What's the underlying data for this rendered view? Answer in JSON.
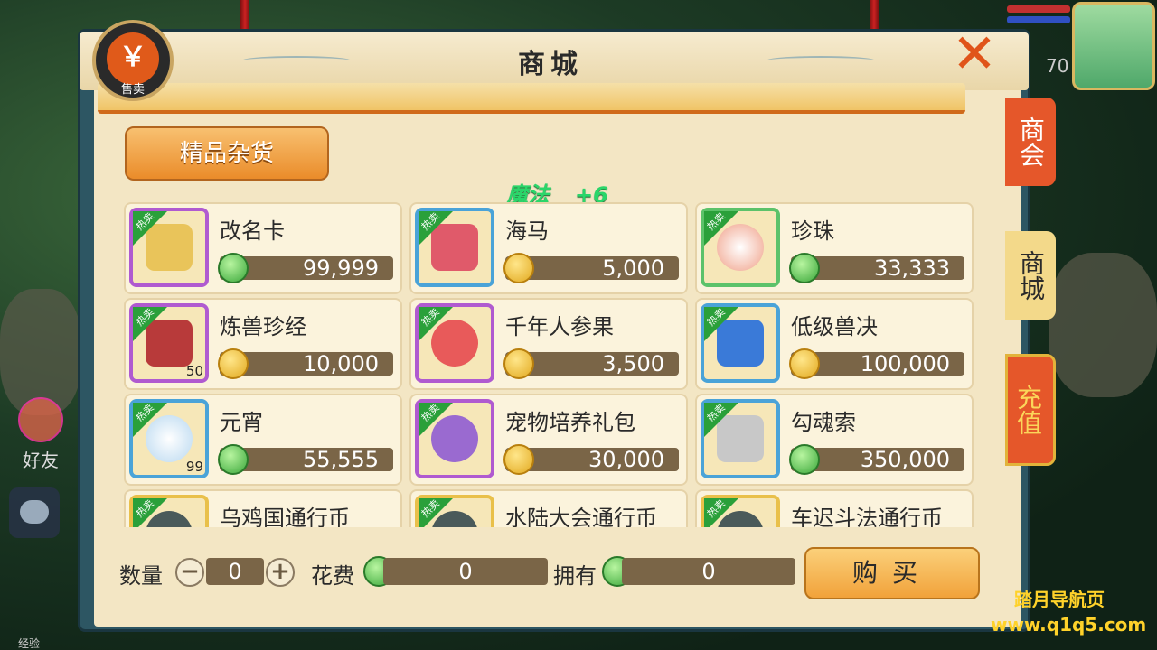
{
  "window": {
    "title": "商城"
  },
  "badge": {
    "label": "售卖",
    "symbol": "￥"
  },
  "category": {
    "label": "精品杂货"
  },
  "buff": {
    "label": "魔法",
    "value": "+6"
  },
  "items": [
    {
      "name": "改名卡",
      "price": "99,999",
      "currency": "jade",
      "frame": "purple",
      "hot": "热卖",
      "qty": ""
    },
    {
      "name": "海马",
      "price": "5,000",
      "currency": "gold",
      "frame": "blue",
      "hot": "热卖",
      "qty": ""
    },
    {
      "name": "珍珠",
      "price": "33,333",
      "currency": "jade",
      "frame": "green",
      "hot": "热卖",
      "qty": ""
    },
    {
      "name": "炼兽珍经",
      "price": "10,000",
      "currency": "gold",
      "frame": "purple",
      "hot": "热卖",
      "qty": "50"
    },
    {
      "name": "千年人参果",
      "price": "3,500",
      "currency": "gold",
      "frame": "purple",
      "hot": "热卖",
      "qty": ""
    },
    {
      "name": "低级兽决",
      "price": "100,000",
      "currency": "gold",
      "frame": "blue",
      "hot": "热卖",
      "qty": ""
    },
    {
      "name": "元宵",
      "price": "55,555",
      "currency": "jade",
      "frame": "blue",
      "hot": "热卖",
      "qty": "99"
    },
    {
      "name": "宠物培养礼包",
      "price": "30,000",
      "currency": "gold",
      "frame": "purple",
      "hot": "热卖",
      "qty": ""
    },
    {
      "name": "勾魂索",
      "price": "350,000",
      "currency": "jade",
      "frame": "blue",
      "hot": "热卖",
      "qty": ""
    },
    {
      "name": "乌鸡国通行币",
      "price": "",
      "currency": "gold",
      "frame": "yellow",
      "hot": "热卖",
      "qty": ""
    },
    {
      "name": "水陆大会通行币",
      "price": "",
      "currency": "gold",
      "frame": "yellow",
      "hot": "热卖",
      "qty": ""
    },
    {
      "name": "车迟斗法通行币",
      "price": "",
      "currency": "gold",
      "frame": "yellow",
      "hot": "热卖",
      "qty": ""
    }
  ],
  "purchase": {
    "qty_label": "数量",
    "qty_value": "0",
    "minus": "−",
    "plus": "+",
    "cost_label": "花费",
    "cost_value": "0",
    "own_label": "拥有",
    "own_value": "0",
    "buy_label": "购买"
  },
  "tabs": {
    "guild": "商会",
    "shop": "商城",
    "recharge": "充值"
  },
  "hud": {
    "friend_label": "好友",
    "level": "70",
    "exp_label": "经验"
  },
  "watermark": {
    "line1": "踏月导航页",
    "line2": "www.q1q5.com"
  },
  "colors": {
    "accent": "#e5572a",
    "price_bg": "#7a6547",
    "hot": "#2aa03a"
  }
}
